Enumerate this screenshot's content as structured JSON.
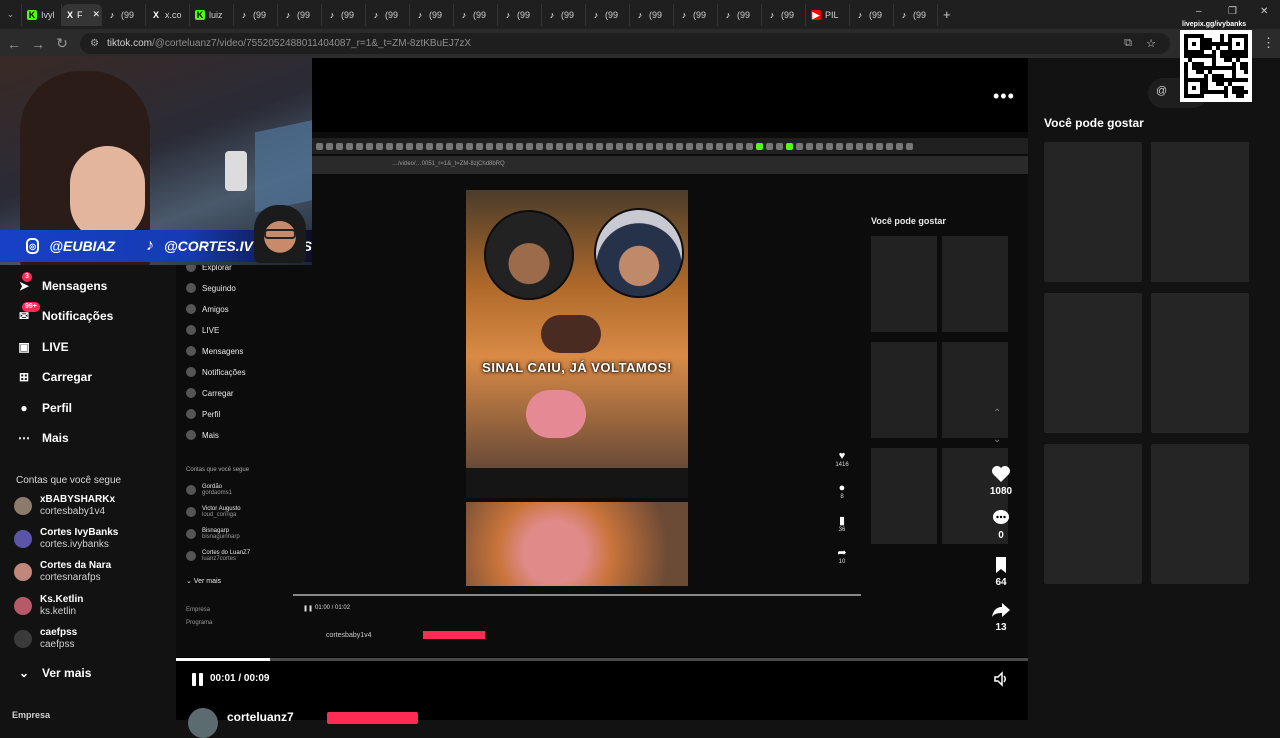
{
  "browser": {
    "tabs": [
      {
        "label": "Ivyl",
        "icon": "kick",
        "active": false
      },
      {
        "label": "F",
        "icon": "x",
        "active": true
      },
      {
        "label": "(99",
        "icon": "tiktok"
      },
      {
        "label": "x.co",
        "icon": "x"
      },
      {
        "label": "luiz",
        "icon": "kick"
      },
      {
        "label": "(99",
        "icon": "tiktok"
      },
      {
        "label": "(99",
        "icon": "tiktok"
      },
      {
        "label": "(99",
        "icon": "tiktok"
      },
      {
        "label": "(99",
        "icon": "tiktok"
      },
      {
        "label": "(99",
        "icon": "tiktok"
      },
      {
        "label": "(99",
        "icon": "tiktok"
      },
      {
        "label": "(99",
        "icon": "tiktok"
      },
      {
        "label": "(99",
        "icon": "tiktok"
      },
      {
        "label": "(99",
        "icon": "tiktok"
      },
      {
        "label": "(99",
        "icon": "tiktok"
      },
      {
        "label": "(99",
        "icon": "tiktok"
      },
      {
        "label": "(99",
        "icon": "tiktok"
      },
      {
        "label": "(99",
        "icon": "tiktok"
      },
      {
        "label": "PIL",
        "icon": "youtube"
      },
      {
        "label": "(99",
        "icon": "tiktok"
      },
      {
        "label": "(99",
        "icon": "tiktok"
      }
    ],
    "new_tab": "+",
    "url_domain": "tiktok.com",
    "url_path": "/@corteluanz7/video/7552052488011404087_r=1&_t=ZM-8ztKBuEJ7zX",
    "window_controls": [
      "–",
      "❐",
      "✕"
    ]
  },
  "overlay": {
    "instagram_handle": "@EUBIAZ",
    "tiktok_handle": "@CORTES.IVYBANKS",
    "qr_label": "livepix.gg/ivybanks"
  },
  "sidebar": {
    "items": [
      {
        "label": "Mensagens",
        "icon": "send-icon",
        "badge": "3"
      },
      {
        "label": "Notificações",
        "icon": "inbox-icon",
        "badge": "99+"
      },
      {
        "label": "LIVE",
        "icon": "live-icon"
      },
      {
        "label": "Carregar",
        "icon": "plus-square-icon"
      },
      {
        "label": "Perfil",
        "icon": "profile-icon"
      },
      {
        "label": "Mais",
        "icon": "more-icon"
      }
    ],
    "following_title": "Contas que você segue",
    "following": [
      {
        "name": "xBABYSHARKx",
        "handle": "cortesbaby1v4",
        "color": "#8c7a6a"
      },
      {
        "name": "Cortes IvyBanks",
        "handle": "cortes.ivybanks",
        "color": "#5a55a8"
      },
      {
        "name": "Cortes da Nara",
        "handle": "cortesnarafps",
        "color": "#c2867a"
      },
      {
        "name": "Ks.Ketlin",
        "handle": "ks.ketlin",
        "color": "#b65a6a"
      },
      {
        "name": "caefpss",
        "handle": "caefpss",
        "color": "#3a3a3a"
      }
    ],
    "see_more": "Ver mais",
    "footer": "Empresa"
  },
  "nested": {
    "url": "…/video/…0051_r=1&_t=ZM-8zjChd8bRQ",
    "menu": [
      "Explorar",
      "Seguindo",
      "Amigos",
      "LIVE",
      "Mensagens",
      "Notificações",
      "Carregar",
      "Perfil",
      "Mais"
    ],
    "following_title": "Contas que você segue",
    "following": [
      {
        "name": "Gordão",
        "handle": "gordaoms1"
      },
      {
        "name": "Victor Augusto",
        "handle": "loud_coringa"
      },
      {
        "name": "Bisnagarp",
        "handle": "bisnaguinharp"
      },
      {
        "name": "Cortes do LuanZ7",
        "handle": "luanz7cortes"
      }
    ],
    "see_more": "Ver mais",
    "footer": [
      "Empresa",
      "Programa"
    ],
    "video_caption": "SINAL CAIU, JÁ VOLTAMOS!",
    "counts": [
      "1416",
      "8",
      "36",
      "10"
    ],
    "suggest_title": "Você pode gostar",
    "time": "01:00 / 01:02",
    "author": "cortesbaby1v4"
  },
  "player": {
    "progress": 0.11,
    "time": "00:01 / 00:09",
    "author": "corteluanz7",
    "likes": "1080",
    "comments": "0",
    "saves": "64",
    "shares": "13"
  },
  "right_panel": {
    "title": "Você pode gostar"
  },
  "colors": {
    "accent": "#fe2c55",
    "background": "#121212",
    "video_bg": "#000000"
  }
}
